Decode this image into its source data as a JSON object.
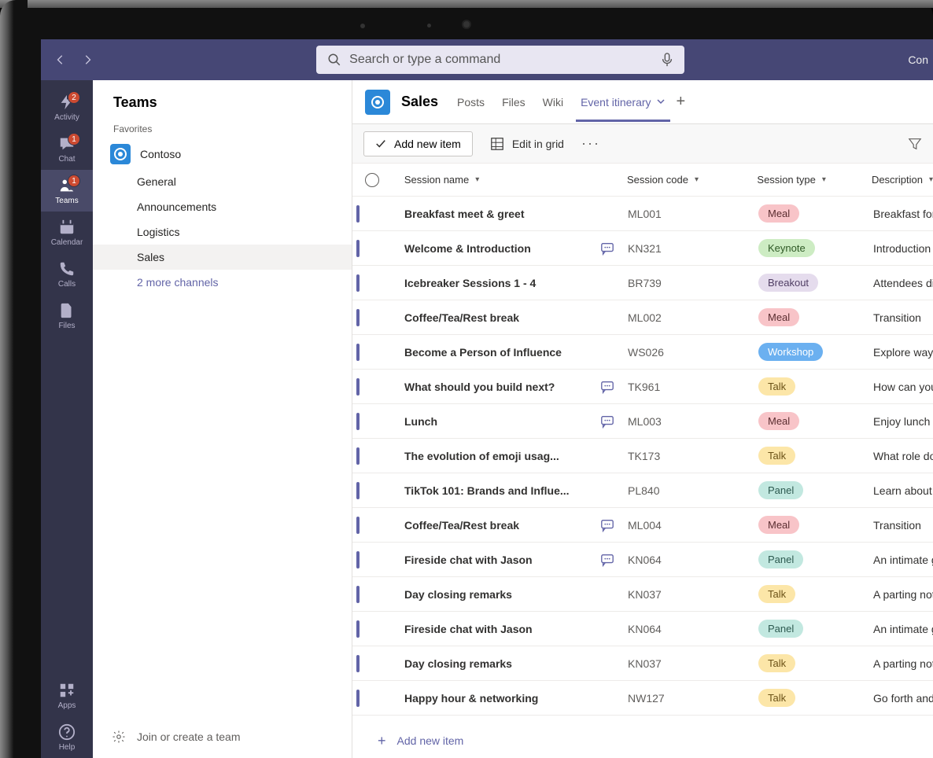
{
  "search": {
    "placeholder": "Search or type a command"
  },
  "titlebar_right": "Con",
  "rail": [
    {
      "label": "Activity",
      "badge": "2"
    },
    {
      "label": "Chat",
      "badge": "1"
    },
    {
      "label": "Teams",
      "badge": "1",
      "active": true
    },
    {
      "label": "Calendar"
    },
    {
      "label": "Calls"
    },
    {
      "label": "Files"
    }
  ],
  "rail_bottom": [
    {
      "label": "Apps"
    },
    {
      "label": "Help"
    }
  ],
  "sidebar": {
    "title": "Teams",
    "section": "Favorites",
    "team_name": "Contoso",
    "channels": [
      {
        "label": "General"
      },
      {
        "label": "Announcements"
      },
      {
        "label": "Logistics"
      },
      {
        "label": "Sales",
        "active": true
      }
    ],
    "more_channels": "2 more channels",
    "footer": "Join or create a team"
  },
  "header": {
    "channel_name": "Sales",
    "tabs": [
      {
        "label": "Posts"
      },
      {
        "label": "Files"
      },
      {
        "label": "Wiki"
      },
      {
        "label": "Event itinerary",
        "active": true,
        "dropdown": true
      }
    ]
  },
  "toolbar": {
    "add_new": "Add new item",
    "edit_grid": "Edit in grid"
  },
  "columns": {
    "name": "Session name",
    "code": "Session code",
    "type": "Session type",
    "desc": "Description"
  },
  "pill_labels": {
    "meal": "Meal",
    "keynote": "Keynote",
    "breakout": "Breakout",
    "workshop": "Workshop",
    "talk": "Talk",
    "panel": "Panel"
  },
  "rows": [
    {
      "name": "Breakfast meet & greet",
      "comments": false,
      "code": "ML001",
      "type": "meal",
      "desc": "Breakfast for all atte"
    },
    {
      "name": "Welcome & Introduction",
      "comments": true,
      "code": "KN321",
      "type": "keynote",
      "desc": "Introduction session"
    },
    {
      "name": "Icebreaker Sessions 1 - 4",
      "comments": false,
      "code": "BR739",
      "type": "breakout",
      "desc": "Attendees divide int"
    },
    {
      "name": "Coffee/Tea/Rest break",
      "comments": false,
      "code": "ML002",
      "type": "meal",
      "desc": "Transition"
    },
    {
      "name": "Become a Person of Influence",
      "comments": false,
      "code": "WS026",
      "type": "workshop",
      "desc": "Explore ways to influ"
    },
    {
      "name": "What should you build next?",
      "comments": true,
      "code": "TK961",
      "type": "talk",
      "desc": "How can you get ov"
    },
    {
      "name": "Lunch",
      "comments": true,
      "code": "ML003",
      "type": "meal",
      "desc": "Enjoy lunch catered"
    },
    {
      "name": "The evolution of emoji usag...",
      "comments": false,
      "code": "TK173",
      "type": "talk",
      "desc": "What role do emojis"
    },
    {
      "name": "TikTok 101: Brands and Influe...",
      "comments": false,
      "code": "PL840",
      "type": "panel",
      "desc": "Learn about creating"
    },
    {
      "name": "Coffee/Tea/Rest break",
      "comments": true,
      "code": "ML004",
      "type": "meal",
      "desc": "Transition"
    },
    {
      "name": "Fireside chat with Jason",
      "comments": true,
      "code": "KN064",
      "type": "panel",
      "desc": "An intimate gatherin"
    },
    {
      "name": "Day closing remarks",
      "comments": false,
      "code": "KN037",
      "type": "talk",
      "desc": "A parting note from"
    },
    {
      "name": "Fireside chat with Jason",
      "comments": false,
      "code": "KN064",
      "type": "panel",
      "desc": "An intimate gatherin"
    },
    {
      "name": "Day closing remarks",
      "comments": false,
      "code": "KN037",
      "type": "talk",
      "desc": "A parting note from"
    },
    {
      "name": "Happy hour & networking",
      "comments": false,
      "code": "NW127",
      "type": "talk",
      "desc": "Go forth and be mer"
    }
  ],
  "add_row": "Add new item"
}
